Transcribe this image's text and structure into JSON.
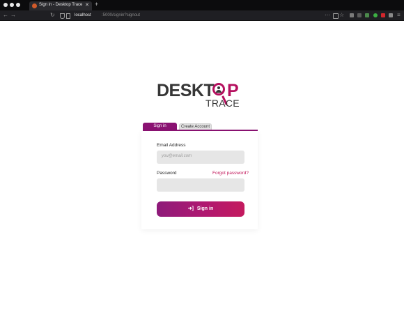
{
  "browser": {
    "tab_title": "Sign in - Desktop Trace",
    "url_host": "localhost",
    "url_path": ":5000/signin?signout"
  },
  "logo": {
    "brand_top_left": "DESKT",
    "brand_top_right": "P",
    "brand_bottom": "TRACE"
  },
  "tabs": {
    "signin": "Sign in",
    "create": "Create Account"
  },
  "form": {
    "email_label": "Email Address",
    "email_placeholder": "you@email.com",
    "password_label": "Password",
    "forgot_label": "Forgot password?",
    "submit_label": "Sign in"
  },
  "colors": {
    "accent": "#8a1272",
    "brand": "#b5105f",
    "link": "#c2185b"
  }
}
